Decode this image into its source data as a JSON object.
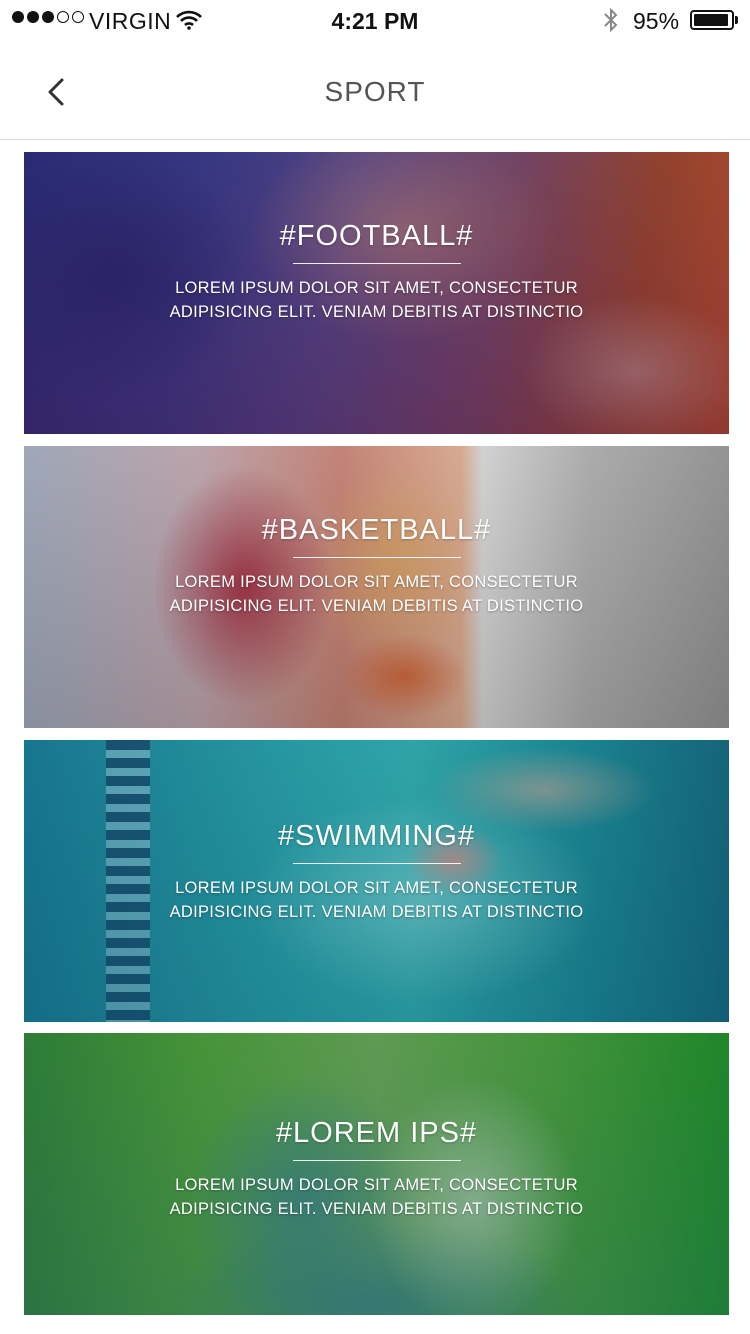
{
  "status_bar": {
    "carrier": "VIRGIN",
    "time": "4:21 PM",
    "battery_percent": "95%",
    "battery_level": 0.95,
    "signal_bars_filled": 3,
    "signal_bars_total": 5,
    "icons": [
      "signal-dots-icon",
      "wifi-icon",
      "bluetooth-icon",
      "battery-icon"
    ]
  },
  "nav": {
    "title": "SPORT",
    "back_icon": "chevron-left-icon"
  },
  "cards": [
    {
      "title": "#FOOTBALL#",
      "description_line1": "LOREM IPSUM DOLOR SIT AMET, CONSECTETUR",
      "description_line2": "ADIPISICING ELIT. VENIAM DEBITIS AT DISTINCTIO"
    },
    {
      "title": "#BASKETBALL#",
      "description_line1": "LOREM IPSUM DOLOR SIT AMET, CONSECTETUR",
      "description_line2": "ADIPISICING ELIT. VENIAM DEBITIS AT DISTINCTIO"
    },
    {
      "title": "#SWIMMING#",
      "description_line1": "LOREM IPSUM DOLOR SIT AMET, CONSECTETUR",
      "description_line2": "ADIPISICING ELIT. VENIAM DEBITIS AT DISTINCTIO"
    },
    {
      "title": "#LOREM IPS#",
      "description_line1": "LOREM IPSUM DOLOR SIT AMET, CONSECTETUR",
      "description_line2": "ADIPISICING ELIT. VENIAM DEBITIS AT DISTINCTIO"
    }
  ],
  "colors": {
    "text_dark": "#111111",
    "nav_title": "#555555",
    "divider": "#dcdcdc",
    "card_text": "#ffffff"
  }
}
